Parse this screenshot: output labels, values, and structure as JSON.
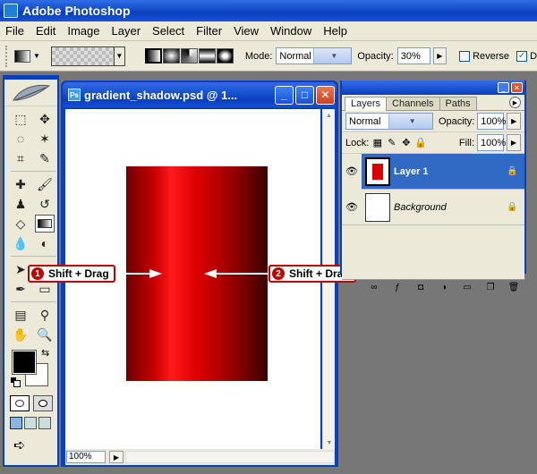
{
  "app": {
    "title": "Adobe Photoshop"
  },
  "menu": [
    "File",
    "Edit",
    "Image",
    "Layer",
    "Select",
    "Filter",
    "View",
    "Window",
    "Help"
  ],
  "options": {
    "mode_label": "Mode:",
    "mode_value": "Normal",
    "opacity_label": "Opacity:",
    "opacity_value": "30%",
    "reverse_label": "Reverse",
    "dither_label": "D"
  },
  "document": {
    "title": "gradient_shadow.psd @ 1...",
    "zoom": "100%"
  },
  "layers_panel": {
    "tabs": [
      "Layers",
      "Channels",
      "Paths"
    ],
    "blend_mode": "Normal",
    "opacity_label": "Opacity:",
    "opacity_value": "100%",
    "lock_label": "Lock:",
    "fill_label": "Fill:",
    "fill_value": "100%",
    "layers": [
      {
        "name": "Layer 1",
        "selected": true
      },
      {
        "name": "Background",
        "selected": false
      }
    ]
  },
  "annotations": [
    {
      "number": "1",
      "text": "Shift + Drag"
    },
    {
      "number": "2",
      "text": "Shift + Drag"
    }
  ],
  "colors": {
    "titlebar": "#0a3fbf",
    "gradient_red": "#ff1a1a",
    "gradient_dark": "#3a0000",
    "callout_border": "#c00000",
    "selected_layer": "#316ac5"
  },
  "icons": {
    "app": "photoshop-icon",
    "foreground_color": "#000000",
    "background_color": "#ffffff"
  }
}
